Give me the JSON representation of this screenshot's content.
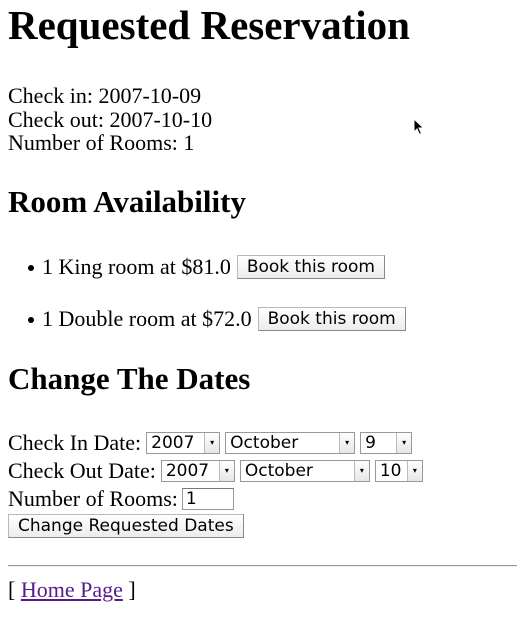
{
  "page_title": "Requested Reservation",
  "request": {
    "check_in_label": "Check in:",
    "check_in_value": "2007-10-09",
    "check_out_label": "Check out:",
    "check_out_value": "2007-10-10",
    "rooms_label": "Number of Rooms:",
    "rooms_value": "1"
  },
  "availability": {
    "heading": "Room Availability",
    "items": [
      {
        "text": "1 King room at $81.0",
        "button": "Book this room"
      },
      {
        "text": "1 Double room at $72.0",
        "button": "Book this room"
      }
    ]
  },
  "change": {
    "heading": "Change The Dates",
    "check_in_label": "Check In Date:",
    "check_in_year": "2007",
    "check_in_month": "October",
    "check_in_day": "9",
    "check_out_label": "Check Out Date:",
    "check_out_year": "2007",
    "check_out_month": "October",
    "check_out_day": "10",
    "rooms_label": "Number of Rooms:",
    "rooms_value": "1",
    "submit_label": "Change Requested Dates"
  },
  "footer": {
    "open_bracket": "[",
    "link_text": "Home Page",
    "close_bracket": "]",
    "link_color": "#551a8b"
  }
}
